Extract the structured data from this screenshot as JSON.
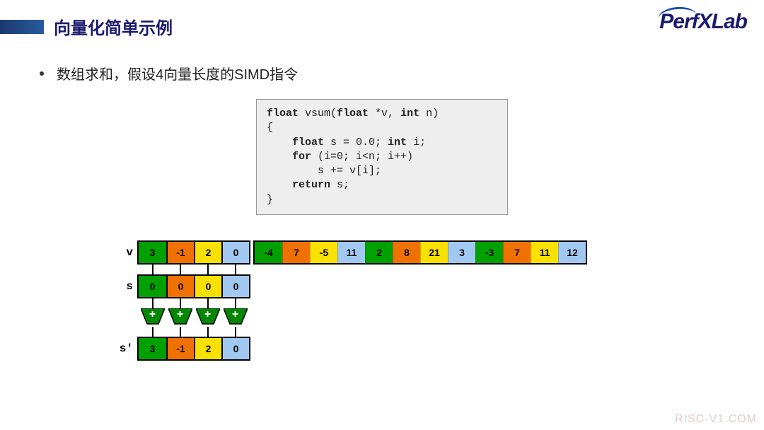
{
  "title": "向量化简单示例",
  "logo_text": "PerfXLab",
  "bullet": "数组求和，假设4向量长度的SIMD指令",
  "code": {
    "sig_pre": "float",
    "sig_mid": " vsum(",
    "sig_arg1_kw": "float",
    "sig_arg1_rest": " *v, ",
    "sig_arg2_kw": "int",
    "sig_arg2_rest": " n)",
    "brace_open": "{",
    "decl_pre": "    ",
    "decl_kw1": "float",
    "decl_mid": " s = 0.0; ",
    "decl_kw2": "int",
    "decl_end": " i;",
    "for_pre": "    ",
    "for_kw": "for",
    "for_rest": " (i=0; i<n; i++)",
    "body": "        s += v[i];",
    "ret_pre": "    ",
    "ret_kw": "return",
    "ret_rest": " s;",
    "brace_close": "}"
  },
  "colors": {
    "green": "#00a000",
    "orange": "#f07000",
    "yellow": "#f8e000",
    "blue": "#a0c8f0"
  },
  "v_label": "v",
  "s_label": "s",
  "sp_label": "s'",
  "plus": "+",
  "v": [
    {
      "val": "3",
      "c": "green"
    },
    {
      "val": "-1",
      "c": "orange"
    },
    {
      "val": "2",
      "c": "yellow"
    },
    {
      "val": "0",
      "c": "blue"
    },
    {
      "val": "-4",
      "c": "green"
    },
    {
      "val": "7",
      "c": "orange"
    },
    {
      "val": "-5",
      "c": "yellow"
    },
    {
      "val": "11",
      "c": "blue"
    },
    {
      "val": "2",
      "c": "green"
    },
    {
      "val": "8",
      "c": "orange"
    },
    {
      "val": "21",
      "c": "yellow"
    },
    {
      "val": "3",
      "c": "blue"
    },
    {
      "val": "-3",
      "c": "green"
    },
    {
      "val": "7",
      "c": "orange"
    },
    {
      "val": "11",
      "c": "yellow"
    },
    {
      "val": "12",
      "c": "blue"
    }
  ],
  "s": [
    {
      "val": "0",
      "c": "green"
    },
    {
      "val": "0",
      "c": "orange"
    },
    {
      "val": "0",
      "c": "yellow"
    },
    {
      "val": "0",
      "c": "blue"
    }
  ],
  "sp": [
    {
      "val": "3",
      "c": "green"
    },
    {
      "val": "-1",
      "c": "orange"
    },
    {
      "val": "2",
      "c": "yellow"
    },
    {
      "val": "0",
      "c": "blue"
    }
  ],
  "watermark": "RISC-V1.COM"
}
